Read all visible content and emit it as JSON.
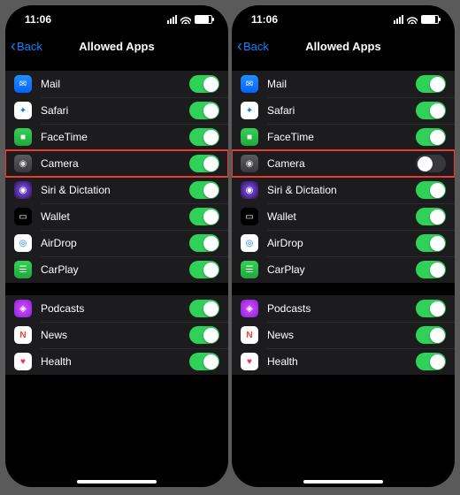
{
  "status": {
    "time": "11:06"
  },
  "nav": {
    "back": "Back",
    "title": "Allowed Apps"
  },
  "icons": {
    "mail": "✉",
    "safari": "✦",
    "facetime": "■",
    "camera": "◉",
    "siri": "◉",
    "wallet": "▭",
    "airdrop": "◎",
    "carplay": "☰",
    "podcasts": "◈",
    "news": "N",
    "health": "♥"
  },
  "left": {
    "groups": [
      {
        "rows": [
          {
            "key": "mail",
            "label": "Mail",
            "on": true,
            "hl": false
          },
          {
            "key": "safari",
            "label": "Safari",
            "on": true,
            "hl": false
          },
          {
            "key": "facetime",
            "label": "FaceTime",
            "on": true,
            "hl": false
          },
          {
            "key": "camera",
            "label": "Camera",
            "on": true,
            "hl": true
          },
          {
            "key": "siri",
            "label": "Siri & Dictation",
            "on": true,
            "hl": false
          },
          {
            "key": "wallet",
            "label": "Wallet",
            "on": true,
            "hl": false
          },
          {
            "key": "airdrop",
            "label": "AirDrop",
            "on": true,
            "hl": false
          },
          {
            "key": "carplay",
            "label": "CarPlay",
            "on": true,
            "hl": false
          }
        ]
      },
      {
        "rows": [
          {
            "key": "podcasts",
            "label": "Podcasts",
            "on": true,
            "hl": false
          },
          {
            "key": "news",
            "label": "News",
            "on": true,
            "hl": false
          },
          {
            "key": "health",
            "label": "Health",
            "on": true,
            "hl": false
          }
        ]
      }
    ]
  },
  "right": {
    "groups": [
      {
        "rows": [
          {
            "key": "mail",
            "label": "Mail",
            "on": true,
            "hl": false
          },
          {
            "key": "safari",
            "label": "Safari",
            "on": true,
            "hl": false
          },
          {
            "key": "facetime",
            "label": "FaceTime",
            "on": true,
            "hl": false
          },
          {
            "key": "camera",
            "label": "Camera",
            "on": false,
            "hl": true
          },
          {
            "key": "siri",
            "label": "Siri & Dictation",
            "on": true,
            "hl": false
          },
          {
            "key": "wallet",
            "label": "Wallet",
            "on": true,
            "hl": false
          },
          {
            "key": "airdrop",
            "label": "AirDrop",
            "on": true,
            "hl": false
          },
          {
            "key": "carplay",
            "label": "CarPlay",
            "on": true,
            "hl": false
          }
        ]
      },
      {
        "rows": [
          {
            "key": "podcasts",
            "label": "Podcasts",
            "on": true,
            "hl": false
          },
          {
            "key": "news",
            "label": "News",
            "on": true,
            "hl": false
          },
          {
            "key": "health",
            "label": "Health",
            "on": true,
            "hl": false
          }
        ]
      }
    ]
  }
}
